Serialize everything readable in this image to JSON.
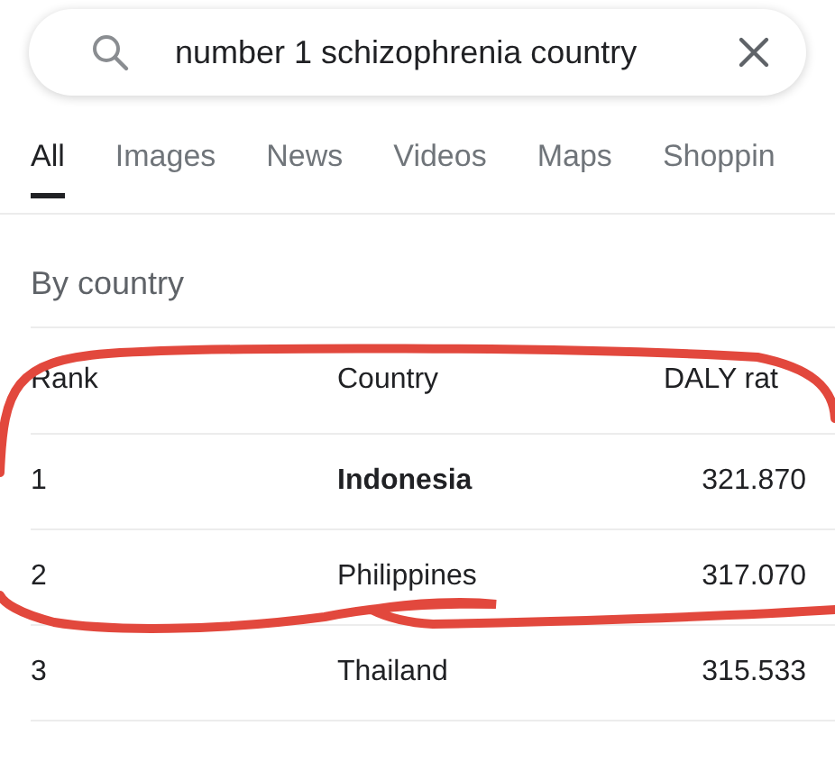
{
  "search": {
    "value": "number 1 schizophrenia country"
  },
  "tabs": [
    {
      "label": "All",
      "selected": true
    },
    {
      "label": "Images",
      "selected": false
    },
    {
      "label": "News",
      "selected": false
    },
    {
      "label": "Videos",
      "selected": false
    },
    {
      "label": "Maps",
      "selected": false
    },
    {
      "label": "Shoppin",
      "selected": false
    }
  ],
  "section_title": "By country",
  "table": {
    "columns": [
      "Rank",
      "Country",
      "DALY rat"
    ],
    "rows": [
      {
        "cells": [
          "1",
          "Indonesia",
          "321.870"
        ],
        "bold": true
      },
      {
        "cells": [
          "2",
          "Philippines",
          "317.070"
        ],
        "bold": false
      },
      {
        "cells": [
          "3",
          "Thailand",
          "315.533"
        ],
        "bold": false
      }
    ]
  }
}
